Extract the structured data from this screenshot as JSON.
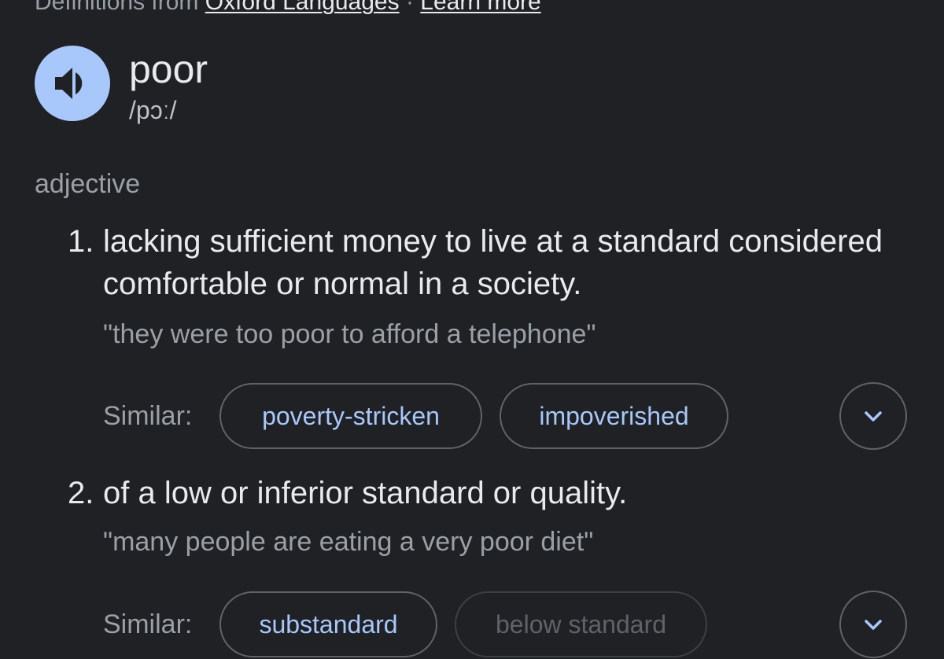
{
  "header": {
    "prefix": "Definitions from",
    "source_link": "Oxford Languages",
    "separator": "·",
    "learn_more": "Learn more"
  },
  "entry": {
    "word": "poor",
    "pronunciation": "/pɔː/",
    "part_of_speech": "adjective",
    "senses": [
      {
        "number": "1.",
        "definition": "lacking sufficient money to live at a standard considered comfortable or normal in a society.",
        "example": "\"they were too poor to afford a telephone\"",
        "similar_label": "Similar:",
        "similar": [
          "poverty-stricken",
          "impoverished"
        ]
      },
      {
        "number": "2.",
        "definition": "of a low or inferior standard or quality.",
        "example": "\"many people are eating a very poor diet\"",
        "similar_label": "Similar:",
        "similar": [
          "substandard",
          "below standard"
        ]
      }
    ]
  },
  "icons": {
    "speaker": "speaker-icon",
    "expand": "chevron-down-icon"
  },
  "colors": {
    "background": "#202124",
    "accent": "#a8c7fa",
    "text": "#e8eaed",
    "muted": "#9aa0a6"
  }
}
